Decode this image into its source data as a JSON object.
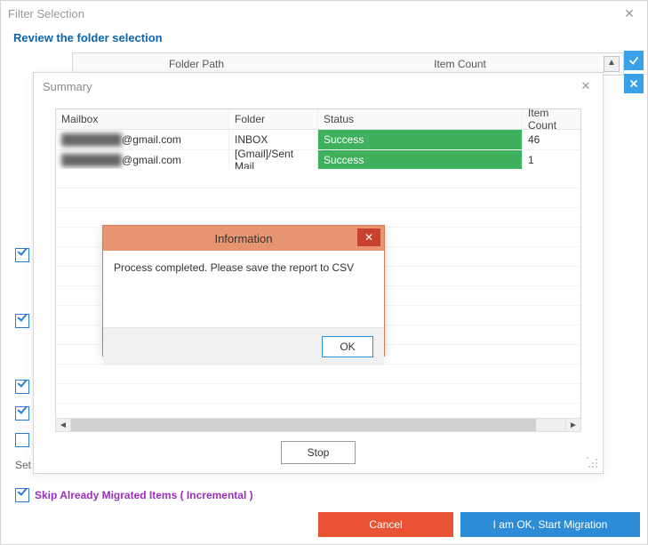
{
  "window": {
    "title": "Filter Selection",
    "subheader": "Review the folder selection"
  },
  "folder_head": {
    "path_label": "Folder Path",
    "count_label": "Item Count"
  },
  "left_checks": [
    {
      "checked": true
    },
    {
      "checked": true
    },
    {
      "checked": true
    },
    {
      "checked": true
    },
    {
      "checked": false
    }
  ],
  "set_label": "Set",
  "skip": {
    "label": "Skip Already Migrated Items ( Incremental )",
    "checked": true
  },
  "buttons": {
    "cancel": "Cancel",
    "start": "I am OK, Start Migration"
  },
  "summary": {
    "title": "Summary",
    "columns": {
      "mailbox": "Mailbox",
      "folder": "Folder",
      "status": "Status",
      "item_count": "Item Count"
    },
    "rows": [
      {
        "mailbox_prefix": "████████",
        "mailbox_domain": "@gmail.com",
        "folder": "INBOX",
        "status": "Success",
        "item_count": "46"
      },
      {
        "mailbox_prefix": "████████",
        "mailbox_domain": "@gmail.com",
        "folder": "[Gmail]/Sent Mail",
        "status": "Success",
        "item_count": "1"
      }
    ],
    "stop": "Stop"
  },
  "info": {
    "title": "Information",
    "message": "Process completed. Please save the report to CSV",
    "ok": "OK"
  }
}
